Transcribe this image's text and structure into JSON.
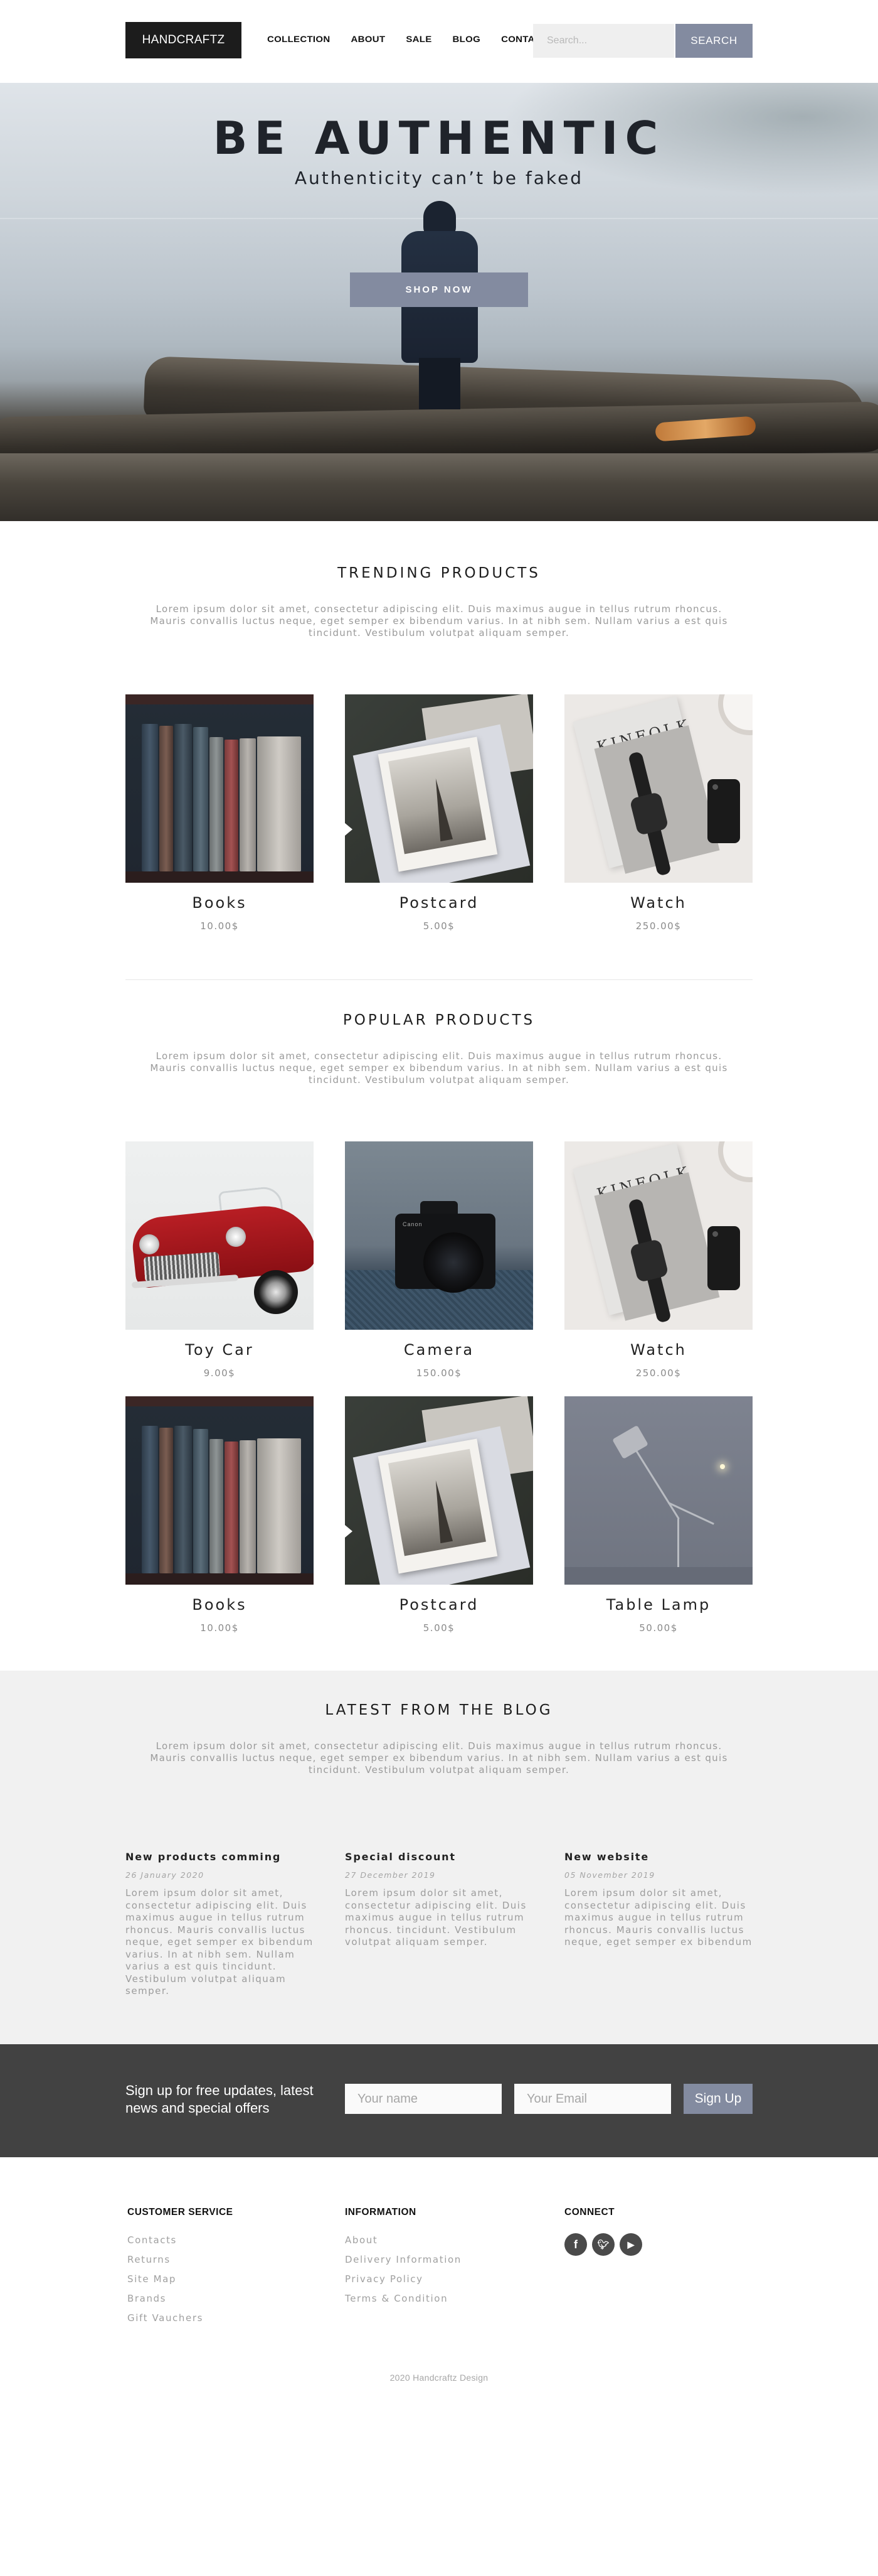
{
  "header": {
    "logo": "HANDCRAFTZ",
    "nav": [
      "COLLECTION",
      "ABOUT",
      "SALE",
      "BLOG",
      "CONTACT"
    ],
    "search_placeholder": "Search...",
    "search_button": "SEARCH"
  },
  "hero": {
    "title": "BE AUTHENTIC",
    "subtitle": "Authenticity can’t be faked",
    "cta": "SHOP NOW"
  },
  "trending": {
    "title": "TRENDING PRODUCTS",
    "description": "Lorem ipsum dolor sit amet, consectetur adipiscing elit. Duis maximus augue in tellus rutrum rhoncus. Mauris convallis luctus neque, eget semper ex bibendum varius. In at nibh sem. Nullam varius a est quis tincidunt. Vestibulum volutpat aliquam semper.",
    "products": [
      {
        "name": "Books",
        "price": "10.00$"
      },
      {
        "name": "Postcard",
        "price": "5.00$"
      },
      {
        "name": "Watch",
        "price": "250.00$"
      }
    ]
  },
  "popular": {
    "title": "POPULAR PRODUCTS",
    "description": "Lorem ipsum dolor sit amet, consectetur adipiscing elit. Duis maximus augue in tellus rutrum rhoncus. Mauris convallis luctus neque, eget semper ex bibendum varius. In at nibh sem. Nullam varius a est quis tincidunt. Vestibulum volutpat aliquam semper.",
    "products": [
      {
        "name": "Toy Car",
        "price": "9.00$"
      },
      {
        "name": "Camera",
        "price": "150.00$"
      },
      {
        "name": "Watch",
        "price": "250.00$"
      },
      {
        "name": "Books",
        "price": "10.00$"
      },
      {
        "name": "Postcard",
        "price": "5.00$"
      },
      {
        "name": "Table Lamp",
        "price": "50.00$"
      }
    ]
  },
  "blog": {
    "title": "LATEST FROM THE BLOG",
    "description": "Lorem ipsum dolor sit amet, consectetur adipiscing elit. Duis maximus augue in tellus rutrum rhoncus. Mauris convallis luctus neque, eget semper ex bibendum varius. In at nibh sem. Nullam varius a est quis tincidunt. Vestibulum volutpat aliquam semper.",
    "posts": [
      {
        "title": "New products comming",
        "date": "26 January 2020",
        "body": "Lorem ipsum dolor sit amet, consectetur adipiscing elit. Duis maximus augue in tellus rutrum rhoncus. Mauris convallis luctus neque, eget semper ex bibendum varius. In at nibh sem. Nullam varius a est quis tincidunt. Vestibulum volutpat aliquam semper."
      },
      {
        "title": "Special discount",
        "date": "27 December 2019",
        "body": "Lorem ipsum dolor sit amet, consectetur adipiscing elit. Duis maximus augue in tellus rutrum rhoncus. tincidunt. Vestibulum volutpat aliquam semper."
      },
      {
        "title": "New website",
        "date": "05 November 2019",
        "body": "Lorem ipsum dolor sit amet, consectetur adipiscing elit. Duis maximus augue in tellus rutrum rhoncus. Mauris convallis luctus neque, eget semper ex bibendum"
      }
    ]
  },
  "signup": {
    "text": "Sign up for free updates, latest news and special offers",
    "name_placeholder": "Your name",
    "email_placeholder": "Your Email",
    "button": "Sign Up"
  },
  "footer": {
    "customer_service": {
      "title": "CUSTOMER SERVICE",
      "links": [
        "Contacts",
        "Returns",
        "Site Map",
        "Brands",
        "Gift Vauchers"
      ]
    },
    "information": {
      "title": "INFORMATION",
      "links": [
        "About",
        "Delivery Information",
        "Privacy Policy",
        "Terms & Condition"
      ]
    },
    "connect": {
      "title": "CONNECT",
      "icons": [
        "facebook-icon",
        "twitter-icon",
        "youtube-icon"
      ]
    },
    "copyright": "2020 Handcraftz Design"
  },
  "colors": {
    "accent": "#838ba0",
    "dark": "#1c1c1c",
    "signup_bg": "#424242",
    "blog_bg": "#f1f1f1"
  }
}
